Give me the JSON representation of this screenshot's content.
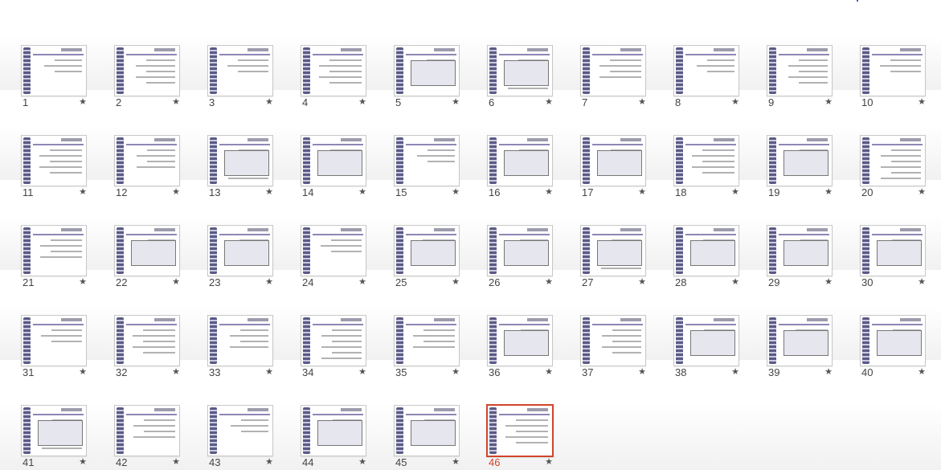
{
  "view": "slide-sorter",
  "accent_selected_color": "#d0462a",
  "selected_slide": "46",
  "star_icon": "star-icon",
  "slides": [
    {
      "number": "1"
    },
    {
      "number": "2"
    },
    {
      "number": "3"
    },
    {
      "number": "4"
    },
    {
      "number": "5"
    },
    {
      "number": "6"
    },
    {
      "number": "7"
    },
    {
      "number": "8"
    },
    {
      "number": "9"
    },
    {
      "number": "10"
    },
    {
      "number": "11"
    },
    {
      "number": "12"
    },
    {
      "number": "13"
    },
    {
      "number": "14"
    },
    {
      "number": "15"
    },
    {
      "number": "16"
    },
    {
      "number": "17"
    },
    {
      "number": "18"
    },
    {
      "number": "19"
    },
    {
      "number": "20"
    },
    {
      "number": "21"
    },
    {
      "number": "22"
    },
    {
      "number": "23"
    },
    {
      "number": "24"
    },
    {
      "number": "25"
    },
    {
      "number": "26"
    },
    {
      "number": "27"
    },
    {
      "number": "28"
    },
    {
      "number": "29"
    },
    {
      "number": "30"
    },
    {
      "number": "31"
    },
    {
      "number": "32"
    },
    {
      "number": "33"
    },
    {
      "number": "34"
    },
    {
      "number": "35"
    },
    {
      "number": "36"
    },
    {
      "number": "37"
    },
    {
      "number": "38"
    },
    {
      "number": "39"
    },
    {
      "number": "40"
    },
    {
      "number": "41"
    },
    {
      "number": "42"
    },
    {
      "number": "43"
    },
    {
      "number": "44"
    },
    {
      "number": "45"
    },
    {
      "number": "46"
    }
  ]
}
